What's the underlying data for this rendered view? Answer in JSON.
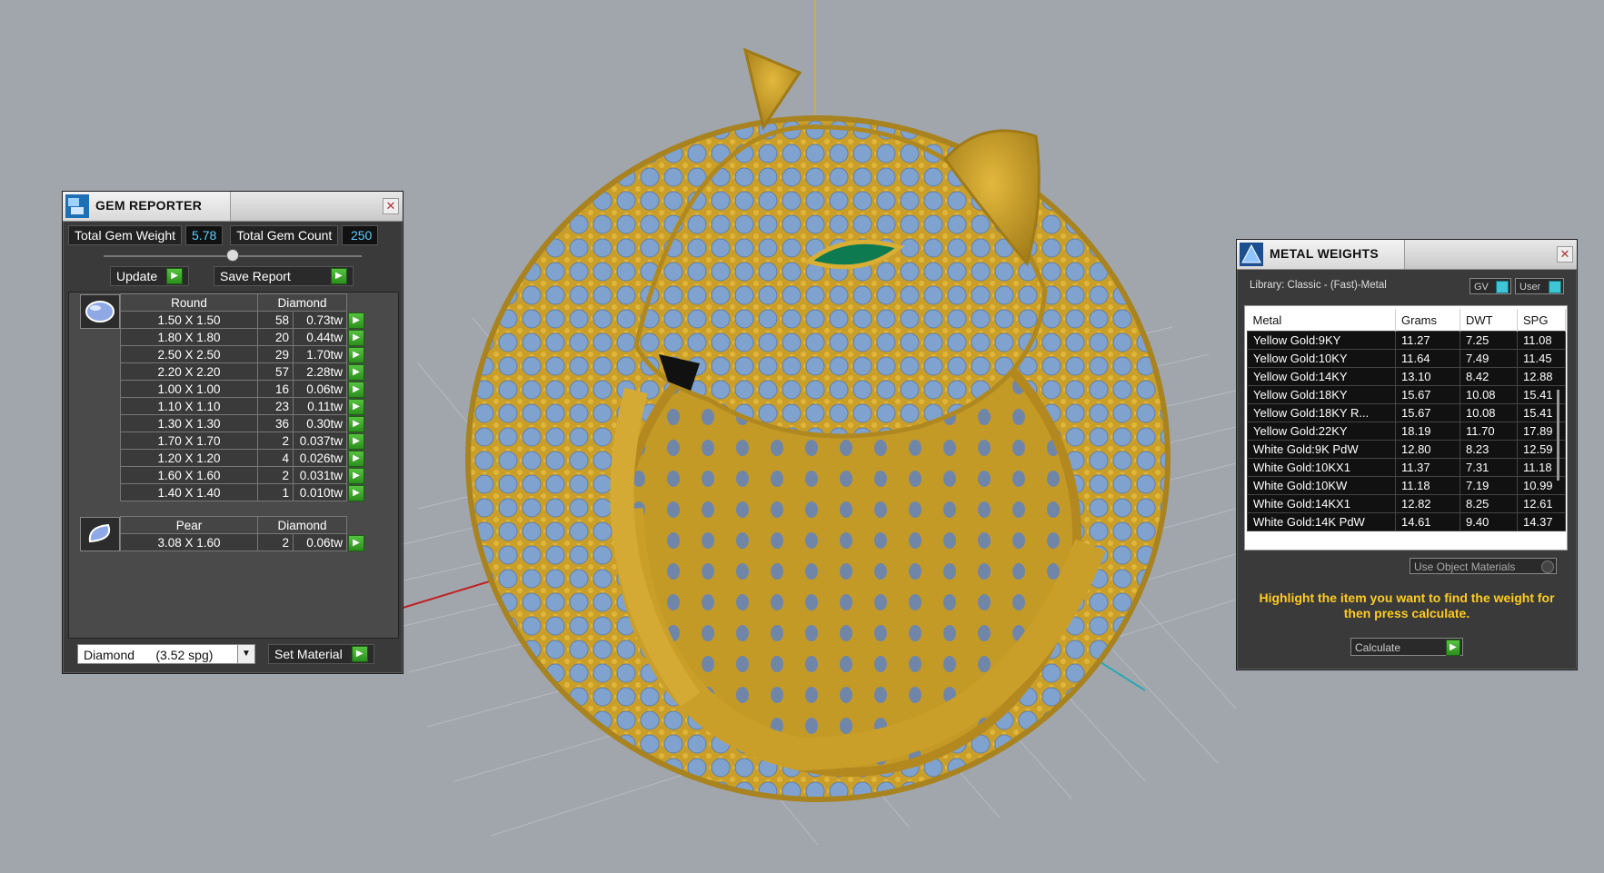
{
  "gem_reporter": {
    "title": "GEM REPORTER",
    "total_weight_label": "Total Gem Weight",
    "total_weight_value": "5.78",
    "total_count_label": "Total Gem Count",
    "total_count_value": "250",
    "update_label": "Update",
    "save_report_label": "Save Report",
    "groups": [
      {
        "shape": "Round",
        "material": "Diamond",
        "icon": "round-gem-icon",
        "rows": [
          {
            "size": "1.50 X 1.50",
            "count": "58",
            "weight": "0.73tw"
          },
          {
            "size": "1.80 X 1.80",
            "count": "20",
            "weight": "0.44tw"
          },
          {
            "size": "2.50 X 2.50",
            "count": "29",
            "weight": "1.70tw"
          },
          {
            "size": "2.20 X 2.20",
            "count": "57",
            "weight": "2.28tw"
          },
          {
            "size": "1.00 X 1.00",
            "count": "16",
            "weight": "0.06tw"
          },
          {
            "size": "1.10 X 1.10",
            "count": "23",
            "weight": "0.11tw"
          },
          {
            "size": "1.30 X 1.30",
            "count": "36",
            "weight": "0.30tw"
          },
          {
            "size": "1.70 X 1.70",
            "count": "2",
            "weight": "0.037tw"
          },
          {
            "size": "1.20 X 1.20",
            "count": "4",
            "weight": "0.026tw"
          },
          {
            "size": "1.60 X 1.60",
            "count": "2",
            "weight": "0.031tw"
          },
          {
            "size": "1.40 X 1.40",
            "count": "1",
            "weight": "0.010tw"
          }
        ]
      },
      {
        "shape": "Pear",
        "material": "Diamond",
        "icon": "pear-gem-icon",
        "rows": [
          {
            "size": "3.08 X 1.60",
            "count": "2",
            "weight": "0.06tw"
          }
        ]
      }
    ],
    "material_select": "Diamond      (3.52 spg)",
    "set_material_label": "Set Material"
  },
  "metal_weights": {
    "title": "METAL WEIGHTS",
    "library": "Library: Classic - (Fast)-Metal",
    "toggle_gv": "GV",
    "toggle_user": "User",
    "columns": [
      "Metal",
      "Grams",
      "DWT",
      "SPG"
    ],
    "rows": [
      [
        "Yellow Gold:9KY",
        "11.27",
        "7.25",
        "11.08"
      ],
      [
        "Yellow Gold:10KY",
        "11.64",
        "7.49",
        "11.45"
      ],
      [
        "Yellow Gold:14KY",
        "13.10",
        "8.42",
        "12.88"
      ],
      [
        "Yellow Gold:18KY",
        "15.67",
        "10.08",
        "15.41"
      ],
      [
        "Yellow Gold:18KY R...",
        "15.67",
        "10.08",
        "15.41"
      ],
      [
        "Yellow Gold:22KY",
        "18.19",
        "11.70",
        "17.89"
      ],
      [
        "White Gold:9K PdW",
        "12.80",
        "8.23",
        "12.59"
      ],
      [
        "White Gold:10KX1",
        "11.37",
        "7.31",
        "11.18"
      ],
      [
        "White Gold:10KW",
        "11.18",
        "7.19",
        "10.99"
      ],
      [
        "White Gold:14KX1",
        "12.82",
        "8.25",
        "12.61"
      ],
      [
        "White Gold:14K PdW",
        "14.61",
        "9.40",
        "14.37"
      ]
    ],
    "use_object_materials": "Use Object Materials",
    "hint": "Highlight the item you want to find the weight for then press calculate.",
    "calculate_label": "Calculate"
  },
  "colors": {
    "viewport_bg": "#a1a6ad",
    "gold": "#c9a02b",
    "gem_blue": "#7fa2cf",
    "emerald": "#0d7a4f",
    "hint_yellow": "#ffcc22"
  }
}
